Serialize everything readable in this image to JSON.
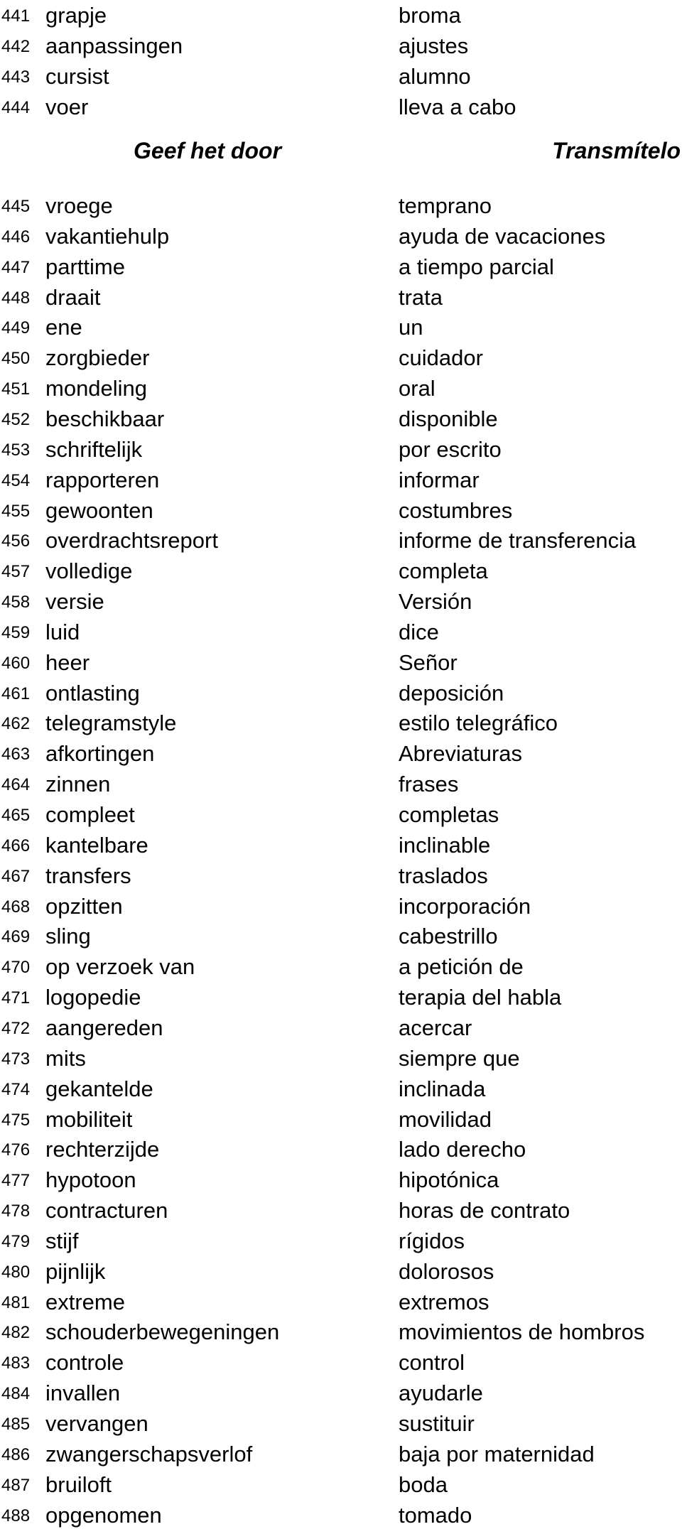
{
  "section_header": {
    "dutch": "Geef het door",
    "spanish": "Transmítelo"
  },
  "rows_before_header": [
    {
      "num": "441",
      "nl": "grapje",
      "es": "broma"
    },
    {
      "num": "442",
      "nl": "aanpassingen",
      "es": "ajustes"
    },
    {
      "num": "443",
      "nl": "cursist",
      "es": "alumno"
    },
    {
      "num": "444",
      "nl": "voer",
      "es": "lleva a cabo"
    }
  ],
  "rows_after_header": [
    {
      "num": "445",
      "nl": "vroege",
      "es": "temprano"
    },
    {
      "num": "446",
      "nl": "vakantiehulp",
      "es": "ayuda de vacaciones"
    },
    {
      "num": "447",
      "nl": "parttime",
      "es": "a tiempo parcial"
    },
    {
      "num": "448",
      "nl": "draait",
      "es": "trata"
    },
    {
      "num": "449",
      "nl": "ene",
      "es": "un"
    },
    {
      "num": "450",
      "nl": "zorgbieder",
      "es": "cuidador"
    },
    {
      "num": "451",
      "nl": "mondeling",
      "es": "oral"
    },
    {
      "num": "452",
      "nl": "beschikbaar",
      "es": "disponible"
    },
    {
      "num": "453",
      "nl": "schriftelijk",
      "es": "por escrito"
    },
    {
      "num": "454",
      "nl": "rapporteren",
      "es": "informar"
    },
    {
      "num": "455",
      "nl": "gewoonten",
      "es": "costumbres"
    },
    {
      "num": "456",
      "nl": "overdrachtsreport",
      "es": "informe de transferencia"
    },
    {
      "num": "457",
      "nl": "volledige",
      "es": "completa"
    },
    {
      "num": "458",
      "nl": "versie",
      "es": "Versión"
    },
    {
      "num": "459",
      "nl": "luid",
      "es": "dice"
    },
    {
      "num": "460",
      "nl": "heer",
      "es": "Señor"
    },
    {
      "num": "461",
      "nl": "ontlasting",
      "es": "deposición"
    },
    {
      "num": "462",
      "nl": "telegramstyle",
      "es": "estilo telegráfico"
    },
    {
      "num": "463",
      "nl": "afkortingen",
      "es": "Abreviaturas"
    },
    {
      "num": "464",
      "nl": "zinnen",
      "es": "frases"
    },
    {
      "num": "465",
      "nl": "compleet",
      "es": "completas"
    },
    {
      "num": "466",
      "nl": "kantelbare",
      "es": "inclinable"
    },
    {
      "num": "467",
      "nl": "transfers",
      "es": "traslados"
    },
    {
      "num": "468",
      "nl": "opzitten",
      "es": "incorporación"
    },
    {
      "num": "469",
      "nl": "sling",
      "es": "cabestrillo"
    },
    {
      "num": "470",
      "nl": "op verzoek van",
      "es": "a petición de"
    },
    {
      "num": "471",
      "nl": "logopedie",
      "es": "terapia del habla"
    },
    {
      "num": "472",
      "nl": "aangereden",
      "es": "acercar"
    },
    {
      "num": "473",
      "nl": "mits",
      "es": "siempre que"
    },
    {
      "num": "474",
      "nl": "gekantelde",
      "es": "inclinada"
    },
    {
      "num": "475",
      "nl": "mobiliteit",
      "es": "movilidad"
    },
    {
      "num": "476",
      "nl": "rechterzijde",
      "es": "lado derecho"
    },
    {
      "num": "477",
      "nl": "hypotoon",
      "es": "hipotónica"
    },
    {
      "num": "478",
      "nl": "contracturen",
      "es": "horas de contrato"
    },
    {
      "num": "479",
      "nl": "stijf",
      "es": "rígidos"
    },
    {
      "num": "480",
      "nl": "pijnlijk",
      "es": "dolorosos"
    },
    {
      "num": "481",
      "nl": "extreme",
      "es": "extremos"
    },
    {
      "num": "482",
      "nl": "schouderbewegeningen",
      "es": "movimientos de hombros"
    },
    {
      "num": "483",
      "nl": "controle",
      "es": "control"
    },
    {
      "num": "484",
      "nl": "invallen",
      "es": "ayudarle"
    },
    {
      "num": "485",
      "nl": "vervangen",
      "es": "sustituir"
    },
    {
      "num": "486",
      "nl": "zwangerschapsverlof",
      "es": "baja por maternidad"
    },
    {
      "num": "487",
      "nl": "bruiloft",
      "es": "boda"
    },
    {
      "num": "488",
      "nl": "opgenomen",
      "es": "tomado"
    }
  ]
}
